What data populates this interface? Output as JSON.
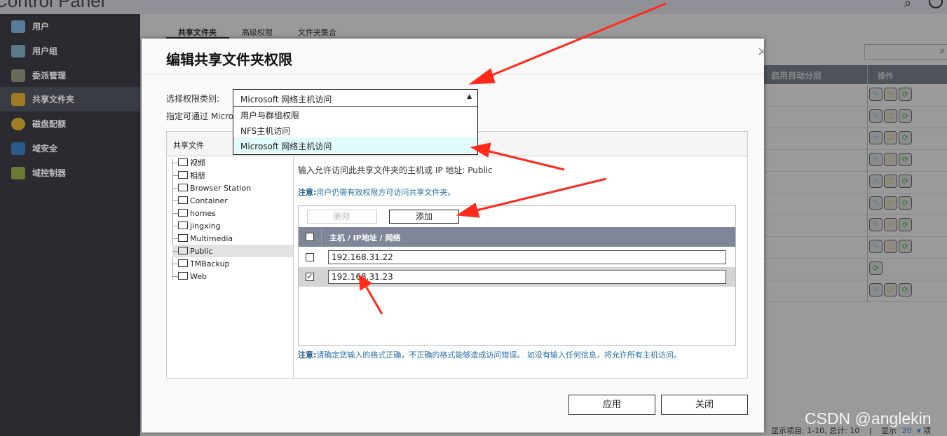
{
  "app": {
    "title": "Control Panel"
  },
  "sidebar": {
    "items": [
      {
        "label": "用户"
      },
      {
        "label": "用户组"
      },
      {
        "label": "委派管理"
      },
      {
        "label": "共享文件夹",
        "active": true
      },
      {
        "label": "磁盘配额"
      },
      {
        "label": "域安全"
      },
      {
        "label": "域控制器"
      }
    ]
  },
  "tabs": [
    {
      "label": "共享文件夹",
      "active": true
    },
    {
      "label": "高级权限"
    },
    {
      "label": "文件夹集合"
    }
  ],
  "table": {
    "col_tiering": "启用自动分层",
    "col_actions": "操作",
    "row_actions": [
      3,
      3,
      3,
      3,
      3,
      3,
      3,
      3,
      1,
      3
    ]
  },
  "footer": {
    "items": "显示项目: 1-10, 总计: 10",
    "sep": "|",
    "show": "显示",
    "per_page": "20",
    "unit": "项"
  },
  "dialog": {
    "title": "编辑共享文件夹权限",
    "close": "×",
    "perm_label": "选择权限类别:",
    "perm_value": "Microsoft 网络主机访问",
    "options": [
      "用户与群组权限",
      "NFS主机访问",
      "Microsoft 网络主机访问"
    ],
    "specify_text": "指定可通过 Micro",
    "panel_header": "共享文件",
    "folders": [
      "视频",
      "相册",
      "Browser Station",
      "Container",
      "homes",
      "jingxing",
      "Multimedia",
      "Public",
      "TMBackup",
      "Web"
    ],
    "selected_folder": "Public",
    "input_hint": "输入允许访问此共享文件夹的主机或 IP 地址:  Public",
    "note1_label": "注意:",
    "note1_text": "用户仍需有效权限方可访问共享文件夹。",
    "delete": "删除",
    "add": "添加",
    "host_header": "主机 / IP地址 / 网络",
    "hosts": [
      {
        "value": "192.168.31.22",
        "checked": false,
        "mark": ""
      },
      {
        "value": "192.168.31.23",
        "checked": true,
        "mark": "✓"
      }
    ],
    "note2_label": "注意:",
    "note2_text": "请确定您输入的格式正确，不正确的格式能够造成访问错误。 如没有输入任何信息，将允许所有主机访问。",
    "apply": "应用",
    "close_btn": "关闭"
  },
  "watermark": "CSDN @anglekin",
  "colors": {
    "annotation_arrow": "#ff2a1a",
    "header": "#7f8698",
    "note": "#2470a8"
  }
}
